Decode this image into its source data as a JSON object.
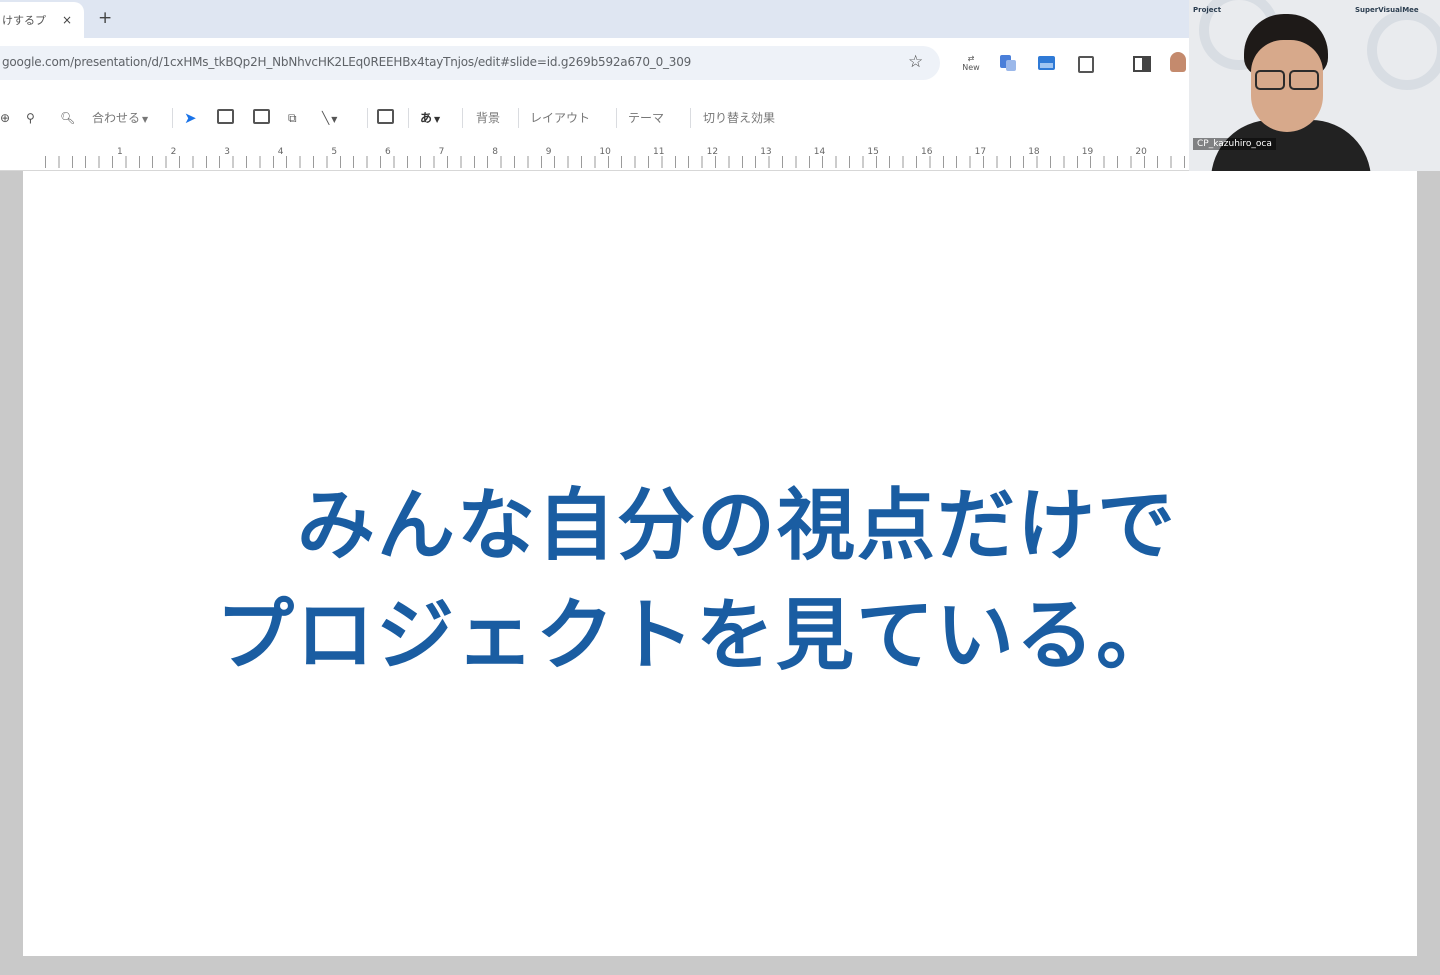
{
  "browser": {
    "tab_title": "けするプロ",
    "tab_close": "×",
    "new_tab": "+",
    "url": "google.com/presentation/d/1cxHMs_tkBQp2H_NbNhvcHK2LEq0REEHBx4tayTnjos/edit#slide=id.g269b592a670_0_309",
    "ext_new_label": "New"
  },
  "toolbar": {
    "zoom_label": "合わせる",
    "text_style_glyph": "あ",
    "background": "背景",
    "layout": "レイアウト",
    "theme": "テーマ",
    "transition": "切り替え効果"
  },
  "ruler": {
    "ticks": [
      "1",
      "2",
      "3",
      "4",
      "5",
      "6",
      "7",
      "8",
      "9",
      "10",
      "11",
      "12",
      "13",
      "14",
      "15",
      "16",
      "17",
      "18",
      "19",
      "20"
    ]
  },
  "slide": {
    "line1": "みんな自分の視点だけで",
    "line2": "プロジェクトを見ている。",
    "text_color": "#1a5da2"
  },
  "webcam": {
    "app_label_left": "Project",
    "app_label_right": "SuperVisualMee",
    "participant_name": "CP_kazuhiro_oca"
  }
}
